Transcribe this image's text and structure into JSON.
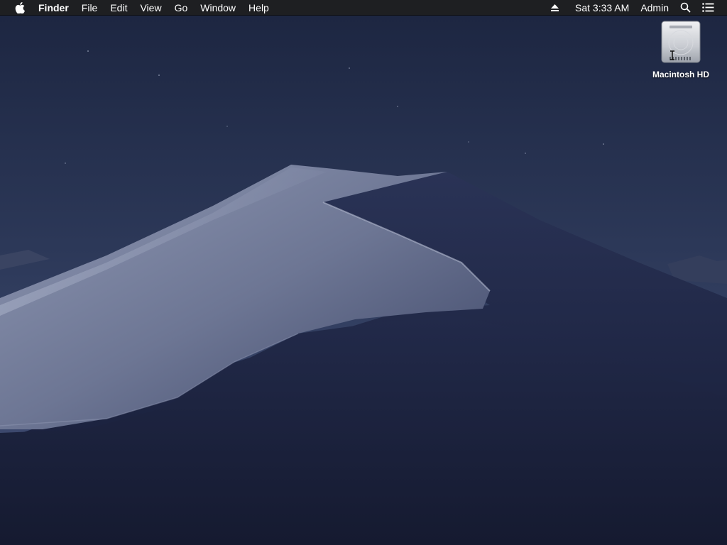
{
  "menubar": {
    "apple_icon": "apple-logo-icon",
    "app_name": "Finder",
    "menus": [
      "File",
      "Edit",
      "View",
      "Go",
      "Window",
      "Help"
    ],
    "eject_icon": "eject-icon",
    "clock": "Sat 3:33 AM",
    "user": "Admin",
    "search_icon": "spotlight-search-icon",
    "notification_icon": "notification-center-icon"
  },
  "desktop": {
    "items": [
      {
        "label": "Macintosh HD",
        "icon": "hard-drive-icon"
      }
    ]
  },
  "colors": {
    "menubar_bg": "#1e1e20",
    "sky_top": "#1d2743",
    "sky_bottom": "#3f4c70",
    "dune_light": "#9aa3bd",
    "dune_dark": "#1a2140"
  }
}
